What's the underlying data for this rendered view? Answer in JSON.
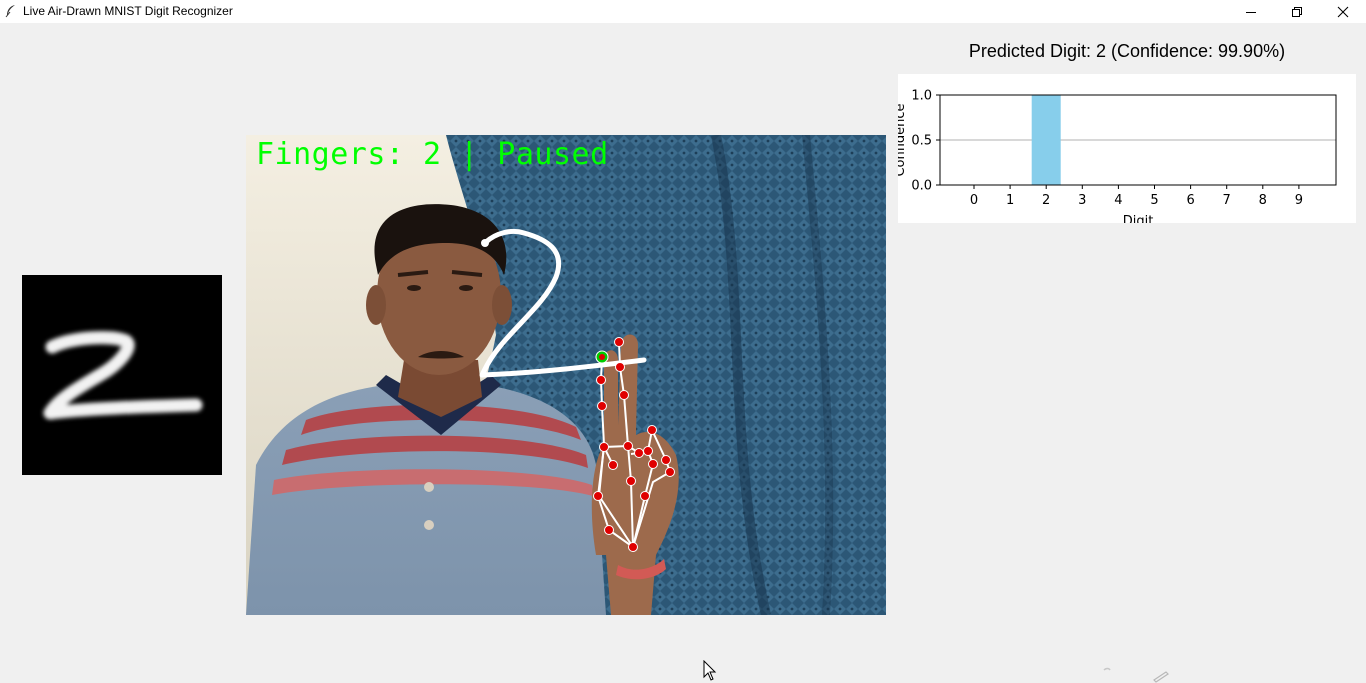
{
  "window": {
    "title": "Live Air-Drawn MNIST Digit Recognizer",
    "controls": [
      "minimize",
      "maximize",
      "close"
    ]
  },
  "prediction": {
    "text": "Predicted Digit: 2 (Confidence: 99.90%)"
  },
  "camera": {
    "overlay_text": "Fingers: 2 | Paused"
  },
  "chart_data": {
    "type": "bar",
    "categories": [
      "0",
      "1",
      "2",
      "3",
      "4",
      "5",
      "6",
      "7",
      "8",
      "9"
    ],
    "values": [
      0,
      0,
      0.999,
      0,
      0,
      0,
      0,
      0,
      0,
      0
    ],
    "xlabel": "Digit",
    "ylabel": "Confidence",
    "ylim": [
      0,
      1.0
    ],
    "yticks": [
      "0.0",
      "0.5",
      "1.0"
    ],
    "bar_color": "#87ceeb",
    "grid": "horizontal at 0.5"
  },
  "colors": {
    "overlay_green": "#00ff00",
    "landmark_red": "#e00000",
    "stroke_white": "#ffffff"
  },
  "icons": {
    "app": "feather-icon",
    "minimize": "minimize-icon",
    "maximize": "restore-icon",
    "close": "close-icon",
    "cursor": "mouse-cursor-icon"
  }
}
